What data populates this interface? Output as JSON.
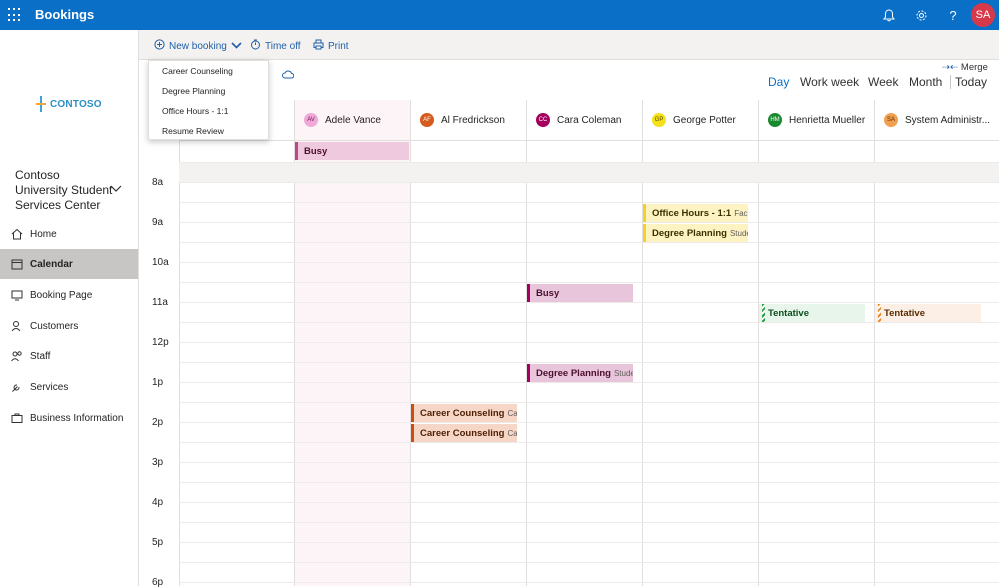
{
  "topbar": {
    "app_title": "Bookings",
    "user_initials": "SA"
  },
  "sidebar": {
    "logo_text": "CONTOSO",
    "org_name": "Contoso University Student Services Center",
    "items": [
      {
        "label": "Home",
        "icon": "home-icon"
      },
      {
        "label": "Calendar",
        "icon": "calendar-icon"
      },
      {
        "label": "Booking Page",
        "icon": "monitor-icon"
      },
      {
        "label": "Customers",
        "icon": "customers-icon"
      },
      {
        "label": "Staff",
        "icon": "staff-icon"
      },
      {
        "label": "Services",
        "icon": "wrench-icon"
      },
      {
        "label": "Business Information",
        "icon": "briefcase-icon"
      }
    ],
    "active_item": "Calendar"
  },
  "commands": {
    "new_booking": "New booking",
    "time_off": "Time off",
    "print": "Print"
  },
  "dropdown": {
    "items": [
      "Career Counseling",
      "Degree Planning",
      "Office Hours - 1:1",
      "Resume Review"
    ]
  },
  "views": {
    "merge": "Merge",
    "day": "Day",
    "work_week": "Work week",
    "week": "Week",
    "month": "Month",
    "today": "Today",
    "active": "Day"
  },
  "staff": [
    {
      "initials": "AV",
      "name": "Adele Vance",
      "color": "#e87bd3"
    },
    {
      "initials": "AF",
      "name": "Al Fredrickson",
      "color": "#d55a1d"
    },
    {
      "initials": "CC",
      "name": "Cara Coleman",
      "color": "#a4005e"
    },
    {
      "initials": "GP",
      "name": "George Potter",
      "color": "#f4e11b"
    },
    {
      "initials": "HM",
      "name": "Henrietta Mueller",
      "color": "#1a8a2e"
    },
    {
      "initials": "SA",
      "name": "System Administr...",
      "color": "#f2a050"
    }
  ],
  "times": [
    "8a",
    "9a",
    "10a",
    "11a",
    "12p",
    "1p",
    "2p",
    "3p",
    "4p",
    "5p",
    "6p"
  ],
  "events": {
    "adele_allday": "Busy",
    "cara_busy": "Busy",
    "cara_degree": "Degree Planning",
    "cara_degree_sub": "Stude",
    "george_office": "Office Hours - 1:1",
    "george_office_sub": "Facult",
    "george_degree": "Degree Planning",
    "george_degree_sub": "Stude",
    "al_career1": "Career Counseling",
    "al_career1_sub": "Care",
    "al_career2": "Career Counseling",
    "al_career2_sub": "Care",
    "henrietta_tentative": "Tentative",
    "sysadmin_tentative": "Tentative"
  }
}
